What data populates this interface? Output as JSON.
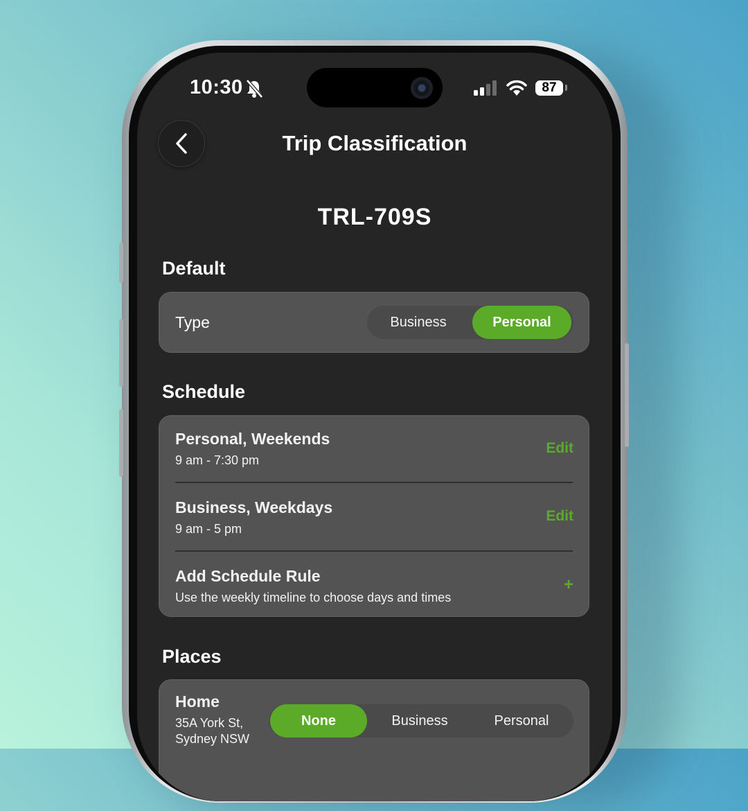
{
  "status_bar": {
    "time": "10:30",
    "battery": "87"
  },
  "header": {
    "title": "Trip Classification",
    "back_icon": "chevron-left-icon"
  },
  "vehicle": {
    "plate": "TRL-709S"
  },
  "default_section": {
    "title": "Default",
    "type_label": "Type",
    "options": [
      "Business",
      "Personal"
    ],
    "selected": "Personal"
  },
  "schedule_section": {
    "title": "Schedule",
    "rules": [
      {
        "title": "Personal, Weekends",
        "time": "9 am - 7:30 pm",
        "action": "Edit"
      },
      {
        "title": "Business, Weekdays",
        "time": "9 am - 5 pm",
        "action": "Edit"
      }
    ],
    "add_rule": {
      "title": "Add Schedule Rule",
      "subtitle": "Use the weekly timeline to choose days and times",
      "icon": "+"
    }
  },
  "places_section": {
    "title": "Places",
    "places": [
      {
        "name": "Home",
        "address_line1": "35A York St,",
        "address_line2": "Sydney NSW",
        "options": [
          "None",
          "Business",
          "Personal"
        ],
        "selected": "None"
      }
    ]
  },
  "colors": {
    "accent": "#5cab28",
    "card": "#535353",
    "background": "#252525"
  }
}
